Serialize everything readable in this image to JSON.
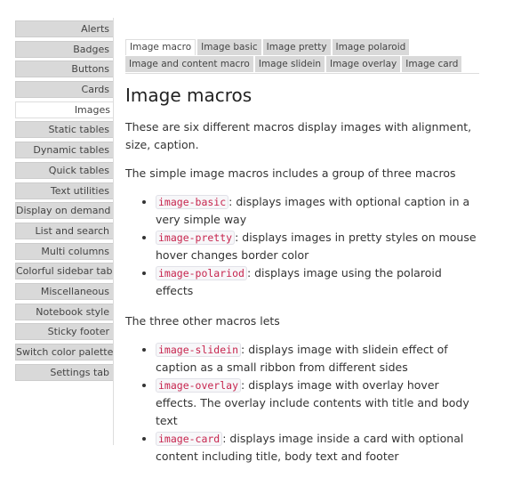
{
  "sidebar": {
    "items": [
      "Alerts",
      "Badges",
      "Buttons",
      "Cards",
      "Images",
      "Static tables",
      "Dynamic tables",
      "Quick tables",
      "Text utilities",
      "Display on demand",
      "List and search",
      "Multi columns",
      "Colorful sidebar tabs",
      "Miscellaneous",
      "Notebook style",
      "Sticky footer",
      "Switch color palettes",
      "Settings tab"
    ],
    "active": "Images"
  },
  "tabs": {
    "row1": [
      "Image macro",
      "Image basic",
      "Image pretty",
      "Image polaroid"
    ],
    "row2": [
      "Image and content macro",
      "Image slidein",
      "Image overlay",
      "Image card"
    ],
    "active": "Image macro"
  },
  "main": {
    "title": "Image macros",
    "intro": "These are six different macros display images with alignment, size, caption.",
    "simple_intro": "The simple image macros includes a group of three macros",
    "simple_items": [
      {
        "code": "image-basic",
        "text": ": displays images with optional caption in a very simple way"
      },
      {
        "code": "image-pretty",
        "text": ": displays images in pretty styles on mouse hover changes border color"
      },
      {
        "code": "image-polariod",
        "text": ": displays image using the polaroid effects"
      }
    ],
    "other_intro": "The three other macros lets",
    "other_items": [
      {
        "code": "image-slidein",
        "text": ": displays image with slidein effect of caption as a small ribbon from different sides"
      },
      {
        "code": "image-overlay",
        "text": ": displays image with overlay hover effects. The overlay include contents with title and body text"
      },
      {
        "code": "image-card",
        "text": ": displays image inside a card with optional content including title, body text and footer"
      }
    ]
  }
}
